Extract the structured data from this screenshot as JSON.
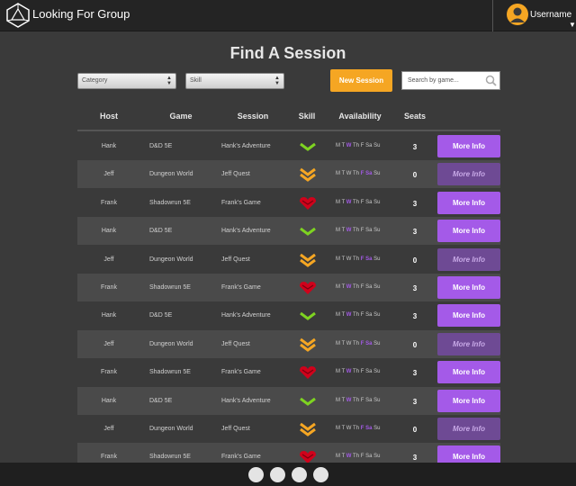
{
  "header": {
    "app_title": "Looking For Group",
    "username": "Username"
  },
  "page": {
    "title": "Find A Session"
  },
  "toolbar": {
    "category_placeholder": "Category",
    "skill_placeholder": "Skill",
    "new_session_label": "New Session",
    "search_placeholder": "Search by game..."
  },
  "table": {
    "columns": [
      "Host",
      "Game",
      "Session",
      "Skill",
      "Availability",
      "Seats"
    ],
    "days": [
      "M",
      "T",
      "W",
      "Th",
      "F",
      "Sa",
      "Su"
    ],
    "more_label": "More Info",
    "rows": [
      {
        "host": "Hank",
        "game": "D&D 5E",
        "session": "Hank's Adventure",
        "skill": "beginner",
        "available": [
          "W"
        ],
        "seats": "3",
        "more_enabled": true
      },
      {
        "host": "Jeff",
        "game": "Dungeon World",
        "session": "Jeff Quest",
        "skill": "intermediate",
        "available": [
          "F",
          "Sa"
        ],
        "seats": "0",
        "more_enabled": false
      },
      {
        "host": "Frank",
        "game": "Shadowrun 5E",
        "session": "Frank's Game",
        "skill": "expert",
        "available": [
          "W"
        ],
        "seats": "3",
        "more_enabled": true
      },
      {
        "host": "Hank",
        "game": "D&D 5E",
        "session": "Hank's Adventure",
        "skill": "beginner",
        "available": [
          "W"
        ],
        "seats": "3",
        "more_enabled": true
      },
      {
        "host": "Jeff",
        "game": "Dungeon World",
        "session": "Jeff Quest",
        "skill": "intermediate",
        "available": [
          "F",
          "Sa"
        ],
        "seats": "0",
        "more_enabled": false
      },
      {
        "host": "Frank",
        "game": "Shadowrun 5E",
        "session": "Frank's Game",
        "skill": "expert",
        "available": [
          "W"
        ],
        "seats": "3",
        "more_enabled": true
      },
      {
        "host": "Hank",
        "game": "D&D 5E",
        "session": "Hank's Adventure",
        "skill": "beginner",
        "available": [
          "W"
        ],
        "seats": "3",
        "more_enabled": true
      },
      {
        "host": "Jeff",
        "game": "Dungeon World",
        "session": "Jeff Quest",
        "skill": "intermediate",
        "available": [
          "F",
          "Sa"
        ],
        "seats": "0",
        "more_enabled": false
      },
      {
        "host": "Frank",
        "game": "Shadowrun 5E",
        "session": "Frank's Game",
        "skill": "expert",
        "available": [
          "W"
        ],
        "seats": "3",
        "more_enabled": true
      },
      {
        "host": "Hank",
        "game": "D&D 5E",
        "session": "Hank's Adventure",
        "skill": "beginner",
        "available": [
          "W"
        ],
        "seats": "3",
        "more_enabled": true
      },
      {
        "host": "Jeff",
        "game": "Dungeon World",
        "session": "Jeff Quest",
        "skill": "intermediate",
        "available": [
          "F",
          "Sa"
        ],
        "seats": "0",
        "more_enabled": false
      },
      {
        "host": "Frank",
        "game": "Shadowrun 5E",
        "session": "Frank's Game",
        "skill": "expert",
        "available": [
          "W"
        ],
        "seats": "3",
        "more_enabled": true
      }
    ]
  },
  "pagination": {
    "pages": 4
  },
  "colors": {
    "accent_purple": "#a45ae8",
    "accent_orange": "#f5a623",
    "skill_beginner": "#7ed321",
    "skill_intermediate": "#f5a623",
    "skill_expert": "#d0021b"
  },
  "icons": {
    "logo": "d20-icon",
    "avatar": "user-avatar-icon",
    "search": "magnifier-icon",
    "skill_beginner": "single-chevron-icon",
    "skill_intermediate": "double-chevron-icon",
    "skill_expert": "heart-chevron-icon"
  }
}
